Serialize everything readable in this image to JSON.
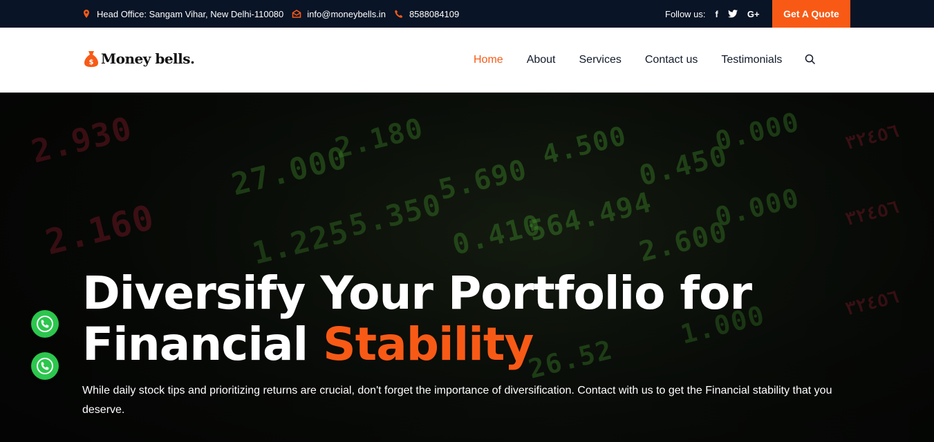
{
  "topbar": {
    "address": "Head Office: Sangam Vihar, New Delhi-110080",
    "email": "info@moneybells.in",
    "phone": "8588084109",
    "follow_label": "Follow us:",
    "social": {
      "facebook": "f",
      "twitter": "t",
      "google": "G+"
    },
    "quote_button": "Get A Quote"
  },
  "nav": {
    "logo_text": "Money bells.",
    "items": [
      "Home",
      "About",
      "Services",
      "Contact us",
      "Testimonials"
    ],
    "active": "Home"
  },
  "hero": {
    "title_line1": "Diversify Your Portfolio for",
    "title_line2_plain": "Financial",
    "title_line2_accent": "Stability",
    "subtitle": "While daily stock tips and prioritizing returns are crucial, don't forget the importance of diversification. Contact with us to get the Financial stability that you deserve."
  },
  "colors": {
    "accent": "#f85a16",
    "topbar_bg": "#091426",
    "whatsapp": "#2cc64d"
  },
  "icons": [
    "location-icon",
    "email-icon",
    "phone-icon",
    "facebook-icon",
    "twitter-icon",
    "google-plus-icon",
    "search-icon",
    "money-bag-icon",
    "whatsapp-icon"
  ]
}
